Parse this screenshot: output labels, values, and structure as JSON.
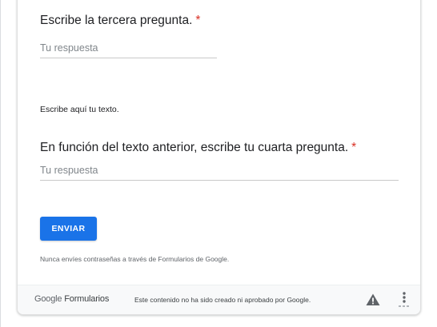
{
  "question3": {
    "title": "Escribe la tercera pregunta.",
    "required_mark": "*",
    "placeholder": "Tu respuesta"
  },
  "section_description": "Escribe aquí tu texto.",
  "question4": {
    "title": "En función del texto anterior, escribe tu cuarta pregunta.",
    "required_mark": "*",
    "placeholder": "Tu respuesta"
  },
  "submit_label": "ENVIAR",
  "password_warning": "Nunca envíes contraseñas a través de Formularios de Google.",
  "footer": {
    "brand_google": "Google",
    "brand_forms": "Formularios",
    "disclaimer": "Este contenido no ha sido creado ni aprobado por Google.",
    "report_icon": "warning-icon",
    "more_icon": "more-vert-icon"
  },
  "colors": {
    "accent": "#1a73e8",
    "required": "#d93025"
  }
}
